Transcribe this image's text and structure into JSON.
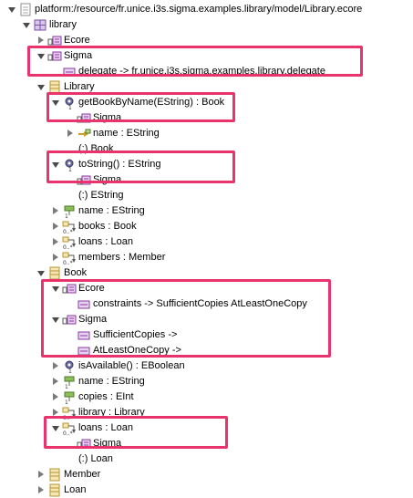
{
  "tree": {
    "nodes": [
      {
        "depth": 0,
        "toggle": "expanded",
        "icon": "resource-file-icon",
        "label": "platform:/resource/fr.unice.i3s.sigma.examples.library/model/Library.ecore",
        "name": "tree-node-resource"
      },
      {
        "depth": 1,
        "toggle": "expanded",
        "icon": "package-icon",
        "label": "library",
        "name": "tree-node-package-library"
      },
      {
        "depth": 2,
        "toggle": "collapsed",
        "icon": "annotation-icon",
        "label": "Ecore",
        "name": "tree-node-annotation-ecore"
      },
      {
        "depth": 2,
        "toggle": "expanded",
        "icon": "annotation-icon",
        "label": "Sigma",
        "name": "tree-node-annotation-sigma"
      },
      {
        "depth": 3,
        "toggle": "none",
        "icon": "entry-icon",
        "label": "delegate -> fr.unice.i3s.sigma.examples.library.delegate",
        "name": "tree-node-entry-delegate"
      },
      {
        "depth": 2,
        "toggle": "expanded",
        "icon": "class-icon",
        "label": "Library",
        "name": "tree-node-class-library"
      },
      {
        "depth": 3,
        "toggle": "expanded",
        "icon": "operation-icon",
        "label": "getBookByName(EString) : Book",
        "name": "tree-node-op-getbookbyname"
      },
      {
        "depth": 4,
        "toggle": "none",
        "icon": "annotation-icon",
        "label": "Sigma",
        "name": "tree-node-annotation-sigma"
      },
      {
        "depth": 4,
        "toggle": "collapsed",
        "icon": "parameter-icon",
        "label": "name : EString",
        "name": "tree-node-param-name"
      },
      {
        "depth": 4,
        "toggle": "none",
        "icon": "generic-type-icon",
        "label": "(:) Book",
        "name": "tree-node-type-book"
      },
      {
        "depth": 3,
        "toggle": "expanded",
        "icon": "operation-icon",
        "label": "toString() : EString",
        "name": "tree-node-op-tostring"
      },
      {
        "depth": 4,
        "toggle": "none",
        "icon": "annotation-icon",
        "label": "Sigma",
        "name": "tree-node-annotation-sigma"
      },
      {
        "depth": 4,
        "toggle": "none",
        "icon": "generic-type-icon",
        "label": "(:) EString",
        "name": "tree-node-type-estring"
      },
      {
        "depth": 3,
        "toggle": "collapsed",
        "icon": "attribute-icon",
        "label": "name : EString",
        "name": "tree-node-attr-name"
      },
      {
        "depth": 3,
        "toggle": "collapsed",
        "icon": "reference-icon",
        "label": "books : Book",
        "name": "tree-node-ref-books"
      },
      {
        "depth": 3,
        "toggle": "collapsed",
        "icon": "reference-icon",
        "label": "loans : Loan",
        "name": "tree-node-ref-loans"
      },
      {
        "depth": 3,
        "toggle": "collapsed",
        "icon": "reference-icon",
        "label": "members : Member",
        "name": "tree-node-ref-members"
      },
      {
        "depth": 2,
        "toggle": "expanded",
        "icon": "class-icon",
        "label": "Book",
        "name": "tree-node-class-book"
      },
      {
        "depth": 3,
        "toggle": "expanded",
        "icon": "annotation-icon",
        "label": "Ecore",
        "name": "tree-node-annotation-ecore"
      },
      {
        "depth": 4,
        "toggle": "none",
        "icon": "entry-icon",
        "label": "constraints -> SufficientCopies AtLeastOneCopy",
        "name": "tree-node-entry-constraints"
      },
      {
        "depth": 3,
        "toggle": "expanded",
        "icon": "annotation-icon",
        "label": "Sigma",
        "name": "tree-node-annotation-sigma"
      },
      {
        "depth": 4,
        "toggle": "none",
        "icon": "entry-icon",
        "label": "SufficientCopies ->",
        "name": "tree-node-entry-sufficientcopies"
      },
      {
        "depth": 4,
        "toggle": "none",
        "icon": "entry-icon",
        "label": "AtLeastOneCopy ->",
        "name": "tree-node-entry-atleastonecopy"
      },
      {
        "depth": 3,
        "toggle": "collapsed",
        "icon": "operation-icon",
        "label": "isAvailable() : EBoolean",
        "name": "tree-node-op-isavailable"
      },
      {
        "depth": 3,
        "toggle": "collapsed",
        "icon": "attribute-icon",
        "label": "name : EString",
        "name": "tree-node-attr-name"
      },
      {
        "depth": 3,
        "toggle": "collapsed",
        "icon": "attribute-icon",
        "label": "copies : EInt",
        "name": "tree-node-attr-copies"
      },
      {
        "depth": 3,
        "toggle": "collapsed",
        "icon": "reference-icon",
        "label": "library : Library",
        "name": "tree-node-ref-library"
      },
      {
        "depth": 3,
        "toggle": "expanded",
        "icon": "reference-icon",
        "label": "loans : Loan",
        "name": "tree-node-ref-loans"
      },
      {
        "depth": 4,
        "toggle": "none",
        "icon": "annotation-icon",
        "label": "Sigma",
        "name": "tree-node-annotation-sigma"
      },
      {
        "depth": 4,
        "toggle": "none",
        "icon": "generic-type-icon",
        "label": "(:) Loan",
        "name": "tree-node-type-loan"
      },
      {
        "depth": 2,
        "toggle": "collapsed",
        "icon": "class-icon",
        "label": "Member",
        "name": "tree-node-class-member"
      },
      {
        "depth": 2,
        "toggle": "collapsed",
        "icon": "class-icon",
        "label": "Loan",
        "name": "tree-node-class-loan"
      }
    ],
    "highlight_color": "#e8336d"
  }
}
